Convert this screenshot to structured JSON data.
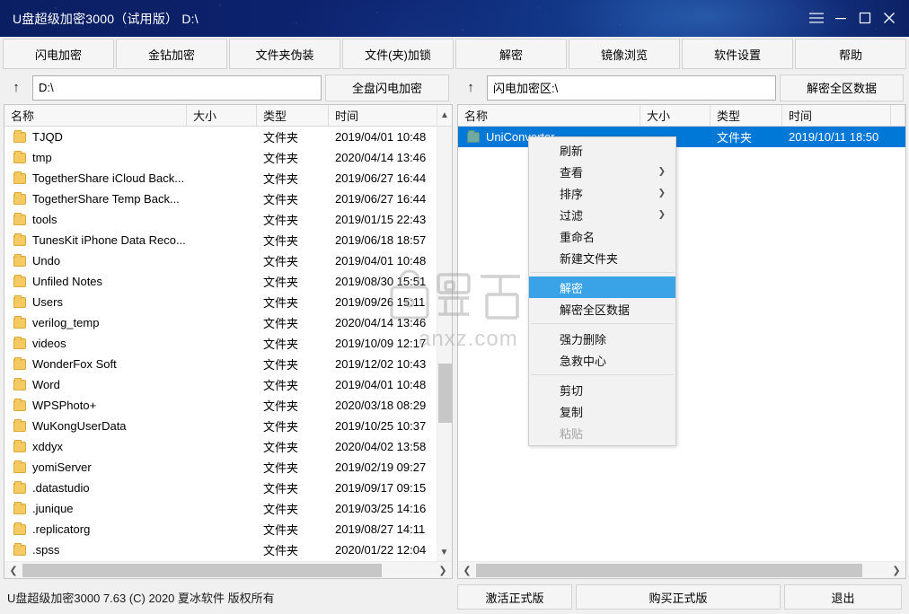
{
  "window": {
    "title": "U盘超级加密3000（试用版）  D:\\",
    "controls": {
      "menu": "hamburger-menu",
      "minimize": "minimize",
      "maximize": "maximize",
      "close": "close"
    }
  },
  "toolbar": {
    "buttons": [
      "闪电加密",
      "金钻加密",
      "文件夹伪装",
      "文件(夹)加锁",
      "解密",
      "镜像浏览",
      "软件设置",
      "帮助"
    ]
  },
  "path_bars": {
    "left": {
      "up_label": "↑",
      "value": "D:\\",
      "placeholder": "D:\\",
      "action": "全盘闪电加密"
    },
    "right": {
      "up_label": "↑",
      "value": "闪电加密区:\\",
      "placeholder": "闪电加密区:\\",
      "action": "解密全区数据"
    }
  },
  "columns": [
    "名称",
    "大小",
    "类型",
    "时间"
  ],
  "left_panel": {
    "rows": [
      {
        "name": "TJQD",
        "size": "",
        "type": "文件夹",
        "time": "2019/04/01 10:48"
      },
      {
        "name": "tmp",
        "size": "",
        "type": "文件夹",
        "time": "2020/04/14 13:46"
      },
      {
        "name": "TogetherShare iCloud Back...",
        "size": "",
        "type": "文件夹",
        "time": "2019/06/27 16:44"
      },
      {
        "name": "TogetherShare Temp Back...",
        "size": "",
        "type": "文件夹",
        "time": "2019/06/27 16:44"
      },
      {
        "name": "tools",
        "size": "",
        "type": "文件夹",
        "time": "2019/01/15 22:43"
      },
      {
        "name": "TunesKit iPhone Data Reco...",
        "size": "",
        "type": "文件夹",
        "time": "2019/06/18 18:57"
      },
      {
        "name": "Undo",
        "size": "",
        "type": "文件夹",
        "time": "2019/04/01 10:48"
      },
      {
        "name": "Unfiled Notes",
        "size": "",
        "type": "文件夹",
        "time": "2019/08/30 15:51"
      },
      {
        "name": "Users",
        "size": "",
        "type": "文件夹",
        "time": "2019/09/26 15:11"
      },
      {
        "name": "verilog_temp",
        "size": "",
        "type": "文件夹",
        "time": "2020/04/14 13:46"
      },
      {
        "name": "videos",
        "size": "",
        "type": "文件夹",
        "time": "2019/10/09 12:17"
      },
      {
        "name": "WonderFox Soft",
        "size": "",
        "type": "文件夹",
        "time": "2019/12/02 10:43"
      },
      {
        "name": "Word",
        "size": "",
        "type": "文件夹",
        "time": "2019/04/01 10:48"
      },
      {
        "name": "WPSPhoto+",
        "size": "",
        "type": "文件夹",
        "time": "2020/03/18 08:29"
      },
      {
        "name": "WuKongUserData",
        "size": "",
        "type": "文件夹",
        "time": "2019/10/25 10:37"
      },
      {
        "name": "xddyx",
        "size": "",
        "type": "文件夹",
        "time": "2020/04/02 13:58"
      },
      {
        "name": "yomiServer",
        "size": "",
        "type": "文件夹",
        "time": "2019/02/19 09:27"
      },
      {
        "name": ".datastudio",
        "size": "",
        "type": "文件夹",
        "time": "2019/09/17 09:15"
      },
      {
        "name": ".junique",
        "size": "",
        "type": "文件夹",
        "time": "2019/03/25 14:16"
      },
      {
        "name": ".replicatorg",
        "size": "",
        "type": "文件夹",
        "time": "2019/08/27 14:11"
      },
      {
        "name": ".spss",
        "size": "",
        "type": "文件夹",
        "time": "2020/01/22 12:04"
      }
    ]
  },
  "right_panel": {
    "rows": [
      {
        "name": "UniConverter",
        "size": "",
        "type": "文件夹",
        "time": "2019/10/11 18:50",
        "selected": true
      }
    ]
  },
  "context_menu": {
    "items": [
      {
        "label": "刷新",
        "submenu": false,
        "highlighted": false,
        "disabled": false
      },
      {
        "label": "查看",
        "submenu": true,
        "highlighted": false,
        "disabled": false
      },
      {
        "label": "排序",
        "submenu": true,
        "highlighted": false,
        "disabled": false
      },
      {
        "label": "过滤",
        "submenu": true,
        "highlighted": false,
        "disabled": false
      },
      {
        "label": "重命名",
        "submenu": false,
        "highlighted": false,
        "disabled": false
      },
      {
        "label": "新建文件夹",
        "submenu": false,
        "highlighted": false,
        "disabled": false
      },
      {
        "separator": true
      },
      {
        "label": "解密",
        "submenu": false,
        "highlighted": true,
        "disabled": false
      },
      {
        "label": "解密全区数据",
        "submenu": false,
        "highlighted": false,
        "disabled": false
      },
      {
        "separator": true
      },
      {
        "label": "强力删除",
        "submenu": false,
        "highlighted": false,
        "disabled": false
      },
      {
        "label": "急救中心",
        "submenu": false,
        "highlighted": false,
        "disabled": false
      },
      {
        "separator": true
      },
      {
        "label": "剪切",
        "submenu": false,
        "highlighted": false,
        "disabled": false
      },
      {
        "label": "复制",
        "submenu": false,
        "highlighted": false,
        "disabled": false
      },
      {
        "label": "粘贴",
        "submenu": false,
        "highlighted": false,
        "disabled": true
      }
    ]
  },
  "watermark": {
    "text": "anxz.com"
  },
  "status": {
    "text": "U盘超级加密3000 7.63 (C) 2020 夏冰软件 版权所有"
  },
  "bottom_buttons": {
    "activate": "激活正式版",
    "buy": "购买正式版",
    "exit": "退出"
  },
  "colors": {
    "title_bar_start": "#0a1f63",
    "title_bar_glow": "#113a8c",
    "selection_blue": "#0078d7",
    "menu_highlight": "#3aa3e8",
    "folder_yellow": "#f6ca62",
    "folder_teal": "#6fa9a3"
  }
}
